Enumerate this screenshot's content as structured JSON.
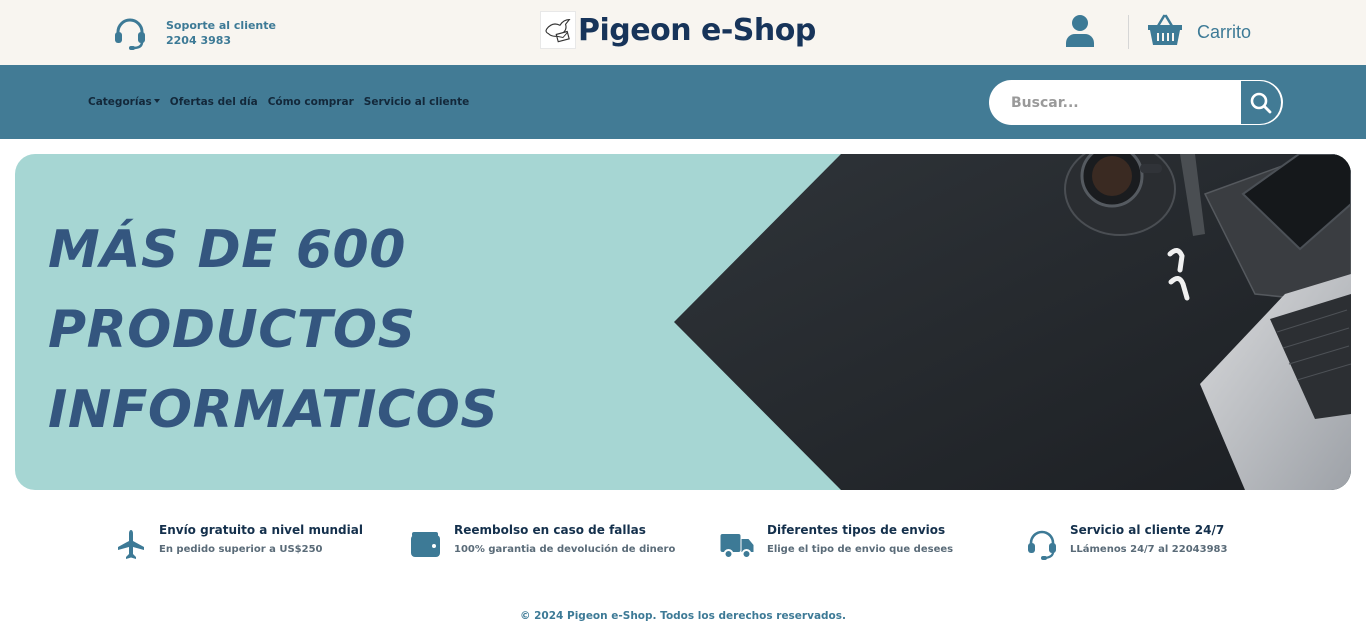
{
  "header": {
    "support_title": "Soporte al cliente",
    "support_phone": "2204 3983",
    "brand_name": "Pigeon e-Shop",
    "cart_label": "Carrito"
  },
  "nav": {
    "items": [
      {
        "label": "Categorías"
      },
      {
        "label": "Ofertas del día"
      },
      {
        "label": "Cómo comprar"
      },
      {
        "label": "Servicio al cliente"
      }
    ]
  },
  "search": {
    "placeholder": "Buscar...",
    "value": ""
  },
  "hero": {
    "lines": [
      "MÁS DE 600",
      "PRODUCTOS",
      "INFORMATICOS"
    ]
  },
  "features": [
    {
      "icon": "airplane-icon",
      "title": "Envío gratuito a nivel mundial",
      "subtitle": "En pedido superior a US$250"
    },
    {
      "icon": "wallet-icon",
      "title": "Reembolso en caso de fallas",
      "subtitle": "100% garantia de devolución de dinero"
    },
    {
      "icon": "truck-icon",
      "title": "Diferentes tipos de envios",
      "subtitle": "Elige el tipo de envio que desees"
    },
    {
      "icon": "headset-icon",
      "title": "Servicio al cliente 24/7",
      "subtitle": "LLámenos 24/7 al 22043983"
    }
  ],
  "footer": {
    "copyright": "© 2024 Pigeon e-Shop. Todos los derechos reservados."
  },
  "colors": {
    "accent": "#427b95",
    "brand_dark": "#17345a",
    "hero_bg": "#a6d6d3",
    "hero_text": "#34567f",
    "topbar_bg": "#f8f5f0"
  }
}
